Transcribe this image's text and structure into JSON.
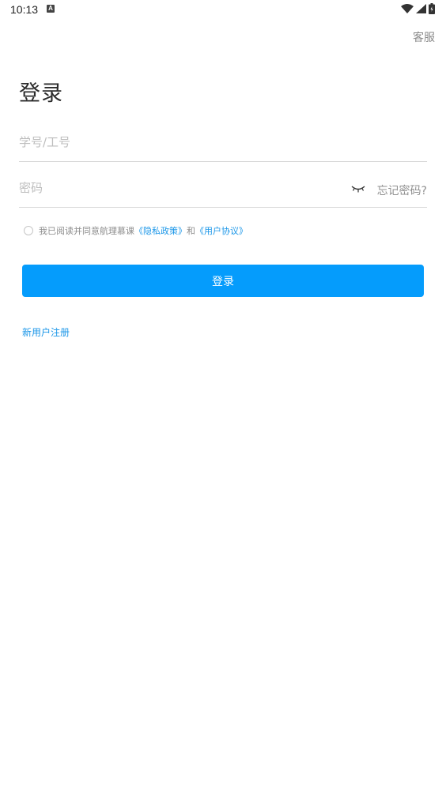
{
  "status_bar": {
    "time": "10:13",
    "notification_icon": "a-badge-icon",
    "icons": [
      "wifi-icon",
      "signal-icon",
      "battery-icon"
    ]
  },
  "header": {
    "service_label": "客服"
  },
  "page": {
    "title": "登录"
  },
  "form": {
    "account_placeholder": "学号/工号",
    "password_placeholder": "密码",
    "password_toggle_icon": "eye-closed-icon",
    "forgot_password_label": "忘记密码?"
  },
  "agreement": {
    "prefix": "我已阅读并同意航理慕课",
    "privacy_link": "《隐私政策》",
    "conjunction": "和",
    "terms_link": "《用户协议》",
    "checked": false
  },
  "actions": {
    "login_label": "登录",
    "register_label": "新用户注册"
  },
  "colors": {
    "primary": "#059cfc",
    "link": "#1a96e8",
    "placeholder": "#bdbdbd",
    "divider": "#d9d9d9"
  }
}
